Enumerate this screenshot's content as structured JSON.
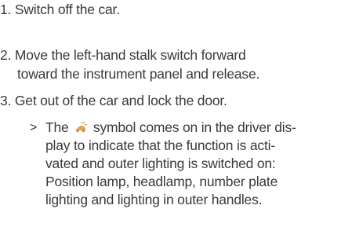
{
  "steps": [
    {
      "number": "1.",
      "text": "Switch off the car."
    },
    {
      "number": "2.",
      "lines": [
        "Move the left-hand stalk switch forward",
        "toward the instrument panel and release."
      ]
    },
    {
      "number": "3.",
      "text": "Get out of the car and lock the door."
    }
  ],
  "result": {
    "marker": ">",
    "line1_before_icon": "The",
    "icon": "home-safe-lighting-icon",
    "line1_after_icon": "symbol comes on in the driver dis-",
    "lines": [
      "play to indicate that the function is acti-",
      "vated and outer lighting is switched on:",
      "Position lamp, headlamp, number plate",
      "lighting and lighting in outer handles."
    ]
  },
  "colors": {
    "text": "#3a3a3a",
    "icon": "#e0a35a"
  }
}
